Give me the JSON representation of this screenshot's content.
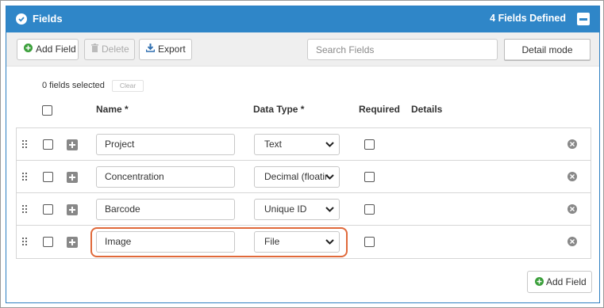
{
  "header": {
    "title": "Fields",
    "count_label": "4 Fields Defined"
  },
  "toolbar": {
    "add_label": "Add Field",
    "delete_label": "Delete",
    "export_label": "Export",
    "search_placeholder": "Search Fields",
    "mode_label": "Detail mode"
  },
  "selection": {
    "count_label": "0 fields selected",
    "clear_label": "Clear"
  },
  "columns": {
    "name": "Name *",
    "type": "Data Type *",
    "required": "Required",
    "details": "Details"
  },
  "rows": [
    {
      "name": "Project",
      "type": "Text"
    },
    {
      "name": "Concentration",
      "type": "Decimal (floating point)"
    },
    {
      "name": "Barcode",
      "type": "Unique ID"
    },
    {
      "name": "Image",
      "type": "File"
    }
  ],
  "footer": {
    "add_label": "Add Field"
  },
  "colors": {
    "header_bg": "#2f86c8",
    "highlight": "#e0693a",
    "add_icon": "#3a9f3a",
    "export_icon": "#2f6fb0"
  },
  "icons": {
    "header": "check-circle-icon",
    "collapse": "minus-square-icon",
    "add": "plus-circle-icon",
    "delete": "trash-icon",
    "export": "download-icon"
  }
}
